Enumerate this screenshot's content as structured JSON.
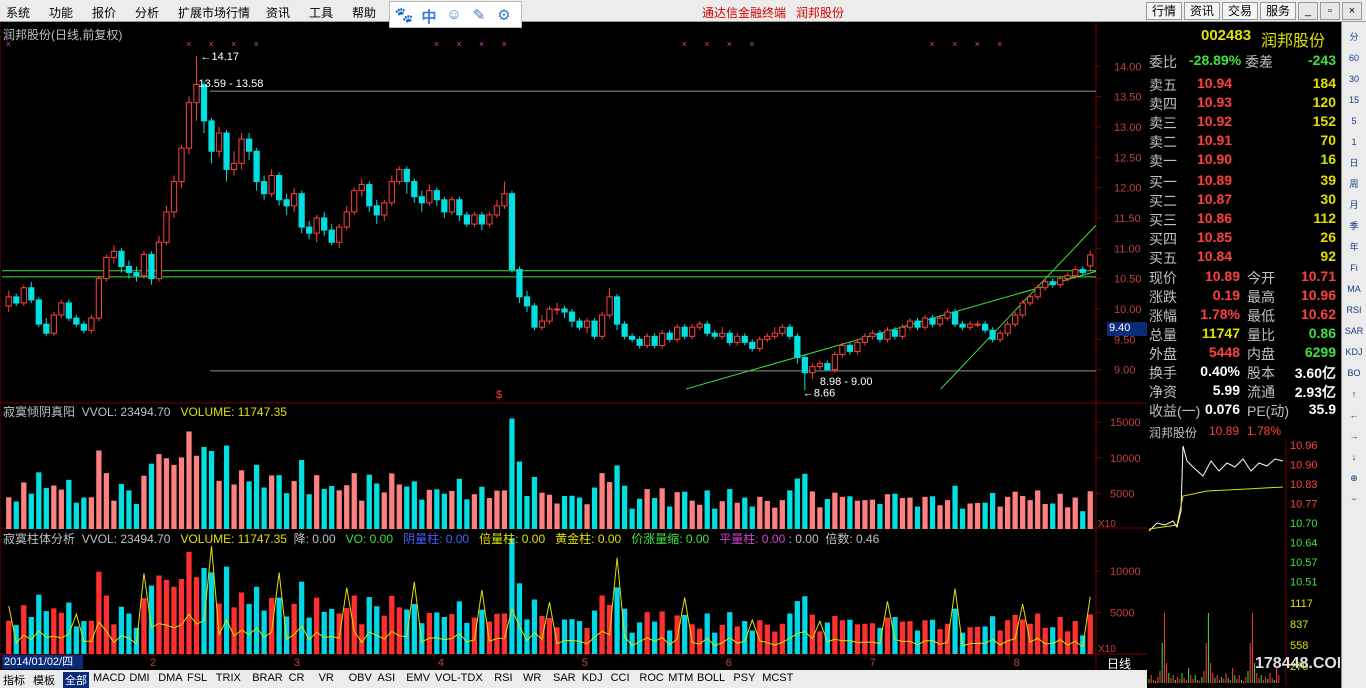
{
  "menu": [
    "系统",
    "功能",
    "报价",
    "分析",
    "扩展市场行情",
    "资讯",
    "工具",
    "帮助"
  ],
  "float_toolbar_icons": [
    "paw-icon",
    "chinese-input-icon",
    "smiley-icon",
    "pen-icon",
    "gear-icon"
  ],
  "float_toolbar_input_glyph": "中",
  "menu_title": {
    "left": "通达信金融终端",
    "right": "润邦股份"
  },
  "right_buttons": [
    "行情",
    "资讯",
    "交易",
    "服务"
  ],
  "chart": {
    "title": "润邦股份(日线,前复权)",
    "price_axis": [
      "14.00",
      "13.50",
      "13.00",
      "12.50",
      "12.00",
      "11.50",
      "11.00",
      "10.50",
      "10.00",
      "9.50",
      "9.00"
    ],
    "price_range": [
      8.5,
      14.4
    ],
    "current_price_label": "9.40",
    "annotations": {
      "high": "14.17",
      "high_range": "13.59 - 13.58",
      "low": "8.66",
      "low_range": "8.98 - 9.00"
    },
    "marker": "$",
    "hlines": [
      13.59,
      10.63,
      10.53,
      8.98
    ],
    "trendlines": [
      {
        "from": [
          0.625,
          8.68
        ],
        "to": [
          1.0,
          10.62
        ]
      },
      {
        "from": [
          0.858,
          8.68
        ],
        "to": [
          1.0,
          11.38
        ]
      }
    ],
    "candles": [
      [
        10.05,
        10.2,
        10.3,
        9.95
      ],
      [
        10.2,
        10.1,
        10.25,
        10.05
      ],
      [
        10.1,
        10.35,
        10.4,
        10.05
      ],
      [
        10.35,
        10.15,
        10.45,
        10.1
      ],
      [
        10.15,
        9.75,
        10.2,
        9.7
      ],
      [
        9.75,
        9.6,
        9.85,
        9.55
      ],
      [
        9.6,
        9.9,
        9.95,
        9.55
      ],
      [
        9.9,
        10.1,
        10.15,
        9.85
      ],
      [
        10.1,
        9.85,
        10.15,
        9.8
      ],
      [
        9.85,
        9.75,
        9.9,
        9.7
      ],
      [
        9.75,
        9.65,
        9.8,
        9.6
      ],
      [
        9.65,
        9.85,
        9.9,
        9.6
      ],
      [
        9.85,
        10.5,
        10.55,
        9.8
      ],
      [
        10.5,
        10.85,
        10.9,
        10.45
      ],
      [
        10.85,
        10.95,
        11.05,
        10.75
      ],
      [
        10.95,
        10.7,
        11.0,
        10.6
      ],
      [
        10.7,
        10.6,
        10.8,
        10.5
      ],
      [
        10.6,
        10.55,
        10.7,
        10.45
      ],
      [
        10.55,
        10.9,
        10.95,
        10.5
      ],
      [
        10.9,
        10.5,
        10.95,
        10.4
      ],
      [
        10.5,
        11.1,
        11.2,
        10.45
      ],
      [
        11.1,
        11.6,
        11.7,
        11.05
      ],
      [
        11.6,
        12.1,
        12.2,
        11.5
      ],
      [
        12.1,
        12.65,
        12.7,
        12.0
      ],
      [
        12.65,
        13.4,
        13.5,
        12.55
      ],
      [
        13.4,
        13.7,
        14.17,
        13.1
      ],
      [
        13.7,
        13.1,
        13.75,
        12.9
      ],
      [
        13.1,
        12.6,
        13.15,
        12.4
      ],
      [
        12.6,
        12.9,
        13.0,
        12.5
      ],
      [
        12.9,
        12.3,
        12.95,
        12.1
      ],
      [
        12.3,
        12.4,
        12.6,
        12.2
      ],
      [
        12.4,
        12.8,
        12.9,
        12.3
      ],
      [
        12.8,
        12.6,
        12.9,
        12.45
      ],
      [
        12.6,
        12.1,
        12.65,
        11.95
      ],
      [
        12.1,
        11.9,
        12.2,
        11.8
      ],
      [
        11.9,
        12.2,
        12.3,
        11.85
      ],
      [
        12.2,
        11.8,
        12.25,
        11.7
      ],
      [
        11.8,
        11.7,
        11.9,
        11.55
      ],
      [
        11.7,
        11.9,
        12.0,
        11.6
      ],
      [
        11.9,
        11.35,
        11.95,
        11.25
      ],
      [
        11.35,
        11.25,
        11.45,
        11.15
      ],
      [
        11.25,
        11.5,
        11.55,
        11.1
      ],
      [
        11.5,
        11.3,
        11.6,
        11.2
      ],
      [
        11.3,
        11.1,
        11.4,
        11.05
      ],
      [
        11.1,
        11.35,
        11.4,
        11.0
      ],
      [
        11.35,
        11.6,
        11.7,
        11.3
      ],
      [
        11.6,
        11.95,
        12.0,
        11.55
      ],
      [
        11.95,
        12.05,
        12.15,
        11.85
      ],
      [
        12.05,
        11.7,
        12.1,
        11.6
      ],
      [
        11.7,
        11.55,
        11.8,
        11.4
      ],
      [
        11.55,
        11.75,
        11.8,
        11.45
      ],
      [
        11.75,
        12.1,
        12.2,
        11.7
      ],
      [
        12.1,
        12.3,
        12.35,
        12.05
      ],
      [
        12.3,
        12.1,
        12.35,
        11.9
      ],
      [
        12.1,
        11.85,
        12.15,
        11.75
      ],
      [
        11.85,
        11.75,
        11.95,
        11.6
      ],
      [
        11.75,
        11.95,
        12.05,
        11.7
      ],
      [
        11.95,
        11.8,
        12.0,
        11.7
      ],
      [
        11.8,
        11.6,
        11.85,
        11.5
      ],
      [
        11.6,
        11.8,
        11.85,
        11.55
      ],
      [
        11.8,
        11.55,
        11.85,
        11.45
      ],
      [
        11.55,
        11.4,
        11.6,
        11.35
      ],
      [
        11.4,
        11.55,
        11.6,
        11.35
      ],
      [
        11.55,
        11.4,
        11.6,
        11.3
      ],
      [
        11.4,
        11.55,
        11.6,
        11.35
      ],
      [
        11.55,
        11.7,
        11.8,
        11.5
      ],
      [
        11.7,
        11.9,
        12.1,
        11.65
      ],
      [
        11.9,
        10.65,
        11.95,
        10.6
      ],
      [
        10.65,
        10.2,
        10.7,
        10.1
      ],
      [
        10.2,
        10.05,
        10.3,
        9.95
      ],
      [
        10.05,
        9.7,
        10.1,
        9.65
      ],
      [
        9.7,
        9.8,
        9.9,
        9.65
      ],
      [
        9.8,
        10.0,
        10.05,
        9.75
      ],
      [
        10.0,
        10.0,
        10.1,
        9.9
      ],
      [
        10.0,
        9.95,
        10.05,
        9.85
      ],
      [
        9.95,
        9.8,
        10.0,
        9.7
      ],
      [
        9.8,
        9.7,
        9.85,
        9.65
      ],
      [
        9.7,
        9.8,
        9.85,
        9.6
      ],
      [
        9.8,
        9.55,
        9.85,
        9.5
      ],
      [
        9.55,
        9.9,
        9.95,
        9.5
      ],
      [
        9.9,
        10.2,
        10.35,
        9.85
      ],
      [
        10.2,
        9.75,
        10.25,
        9.65
      ],
      [
        9.75,
        9.55,
        9.8,
        9.5
      ],
      [
        9.55,
        9.5,
        9.6,
        9.45
      ],
      [
        9.5,
        9.4,
        9.55,
        9.35
      ],
      [
        9.4,
        9.55,
        9.6,
        9.35
      ],
      [
        9.55,
        9.4,
        9.6,
        9.35
      ],
      [
        9.4,
        9.6,
        9.65,
        9.35
      ],
      [
        9.6,
        9.5,
        9.65,
        9.45
      ],
      [
        9.5,
        9.7,
        9.75,
        9.45
      ],
      [
        9.7,
        9.55,
        9.75,
        9.5
      ],
      [
        9.55,
        9.7,
        9.75,
        9.5
      ],
      [
        9.7,
        9.75,
        9.8,
        9.65
      ],
      [
        9.75,
        9.6,
        9.8,
        9.55
      ],
      [
        9.6,
        9.55,
        9.65,
        9.5
      ],
      [
        9.55,
        9.6,
        9.7,
        9.5
      ],
      [
        9.6,
        9.45,
        9.65,
        9.4
      ],
      [
        9.45,
        9.55,
        9.6,
        9.4
      ],
      [
        9.55,
        9.45,
        9.6,
        9.4
      ],
      [
        9.45,
        9.35,
        9.5,
        9.3
      ],
      [
        9.35,
        9.5,
        9.55,
        9.3
      ],
      [
        9.5,
        9.55,
        9.6,
        9.45
      ],
      [
        9.55,
        9.6,
        9.7,
        9.5
      ],
      [
        9.6,
        9.7,
        9.75,
        9.55
      ],
      [
        9.7,
        9.55,
        9.75,
        9.5
      ],
      [
        9.55,
        9.2,
        9.6,
        9.1
      ],
      [
        9.2,
        8.95,
        9.25,
        8.66
      ],
      [
        8.95,
        9.05,
        9.1,
        8.85
      ],
      [
        9.05,
        9.1,
        9.15,
        9.0
      ],
      [
        9.1,
        9.0,
        9.15,
        8.98
      ],
      [
        9.0,
        9.25,
        9.3,
        8.95
      ],
      [
        9.25,
        9.4,
        9.45,
        9.2
      ],
      [
        9.4,
        9.3,
        9.45,
        9.25
      ],
      [
        9.3,
        9.45,
        9.5,
        9.25
      ],
      [
        9.45,
        9.55,
        9.6,
        9.4
      ],
      [
        9.55,
        9.6,
        9.65,
        9.5
      ],
      [
        9.6,
        9.5,
        9.65,
        9.45
      ],
      [
        9.5,
        9.65,
        9.7,
        9.45
      ],
      [
        9.65,
        9.55,
        9.7,
        9.5
      ],
      [
        9.55,
        9.7,
        9.75,
        9.5
      ],
      [
        9.7,
        9.8,
        9.85,
        9.65
      ],
      [
        9.8,
        9.7,
        9.85,
        9.65
      ],
      [
        9.7,
        9.85,
        9.9,
        9.65
      ],
      [
        9.85,
        9.75,
        9.9,
        9.7
      ],
      [
        9.75,
        9.85,
        9.9,
        9.7
      ],
      [
        9.85,
        9.95,
        10.0,
        9.8
      ],
      [
        9.95,
        9.75,
        10.0,
        9.7
      ],
      [
        9.75,
        9.7,
        9.8,
        9.65
      ],
      [
        9.7,
        9.75,
        9.8,
        9.65
      ],
      [
        9.75,
        9.75,
        9.8,
        9.7
      ],
      [
        9.75,
        9.65,
        9.8,
        9.6
      ],
      [
        9.65,
        9.5,
        9.7,
        9.45
      ],
      [
        9.5,
        9.6,
        9.65,
        9.45
      ],
      [
        9.6,
        9.75,
        9.8,
        9.55
      ],
      [
        9.75,
        9.9,
        9.95,
        9.7
      ],
      [
        9.9,
        10.1,
        10.15,
        9.85
      ],
      [
        10.1,
        10.2,
        10.25,
        10.05
      ],
      [
        10.2,
        10.35,
        10.4,
        10.15
      ],
      [
        10.35,
        10.45,
        10.5,
        10.3
      ],
      [
        10.45,
        10.4,
        10.5,
        10.35
      ],
      [
        10.4,
        10.5,
        10.55,
        10.35
      ],
      [
        10.5,
        10.55,
        10.6,
        10.45
      ],
      [
        10.55,
        10.65,
        10.7,
        10.5
      ],
      [
        10.65,
        10.6,
        10.7,
        10.55
      ],
      [
        10.71,
        10.89,
        10.96,
        10.62
      ]
    ],
    "volume_title": {
      "name": "寂寞倾阴真阳",
      "vvol": "VVOL: 23494.70",
      "volume": "VOLUME: 11747.35"
    },
    "volume_axis": [
      "15000",
      "10000",
      "5000"
    ],
    "volume_scale": "X10",
    "indicator_title": {
      "name": "寂寞柱体分析",
      "vvol": "VVOL: 23494.70",
      "volume": "VOLUME: 11747.35",
      "jiang": "降: 0.00",
      "vo": "VO: 0.00",
      "yinliang": "阴量柱: 0.00",
      "beiliang": "倍量柱: 0.00",
      "huangjin": "黄金柱: 0.00",
      "jiazhang": "价涨量缩: 0.00",
      "pingliang": "平量柱: 0.00",
      "tail": ": 0.00",
      "beishu": "倍数: 0.46"
    },
    "indicator_axis": [
      "10000",
      "5000"
    ],
    "date_label": "2014/01/02/四",
    "month_labels": [
      "2",
      "3",
      "4",
      "5",
      "6",
      "7",
      "8"
    ],
    "period": "日线",
    "colors": {
      "up": "#ff4040",
      "down": "#00e0e0",
      "vol_up": "#ff8080",
      "line": "#40e040",
      "grid": "#7a0000"
    }
  },
  "quote": {
    "code": "002483",
    "name": "润邦股份",
    "weibi": {
      "label": "委比",
      "value": "-28.89%",
      "label2": "委差",
      "value2": "-243"
    },
    "asks": [
      [
        "卖五",
        "10.94",
        "184"
      ],
      [
        "卖四",
        "10.93",
        "120"
      ],
      [
        "卖三",
        "10.92",
        "152"
      ],
      [
        "卖二",
        "10.91",
        "70"
      ],
      [
        "卖一",
        "10.90",
        "16"
      ]
    ],
    "bids": [
      [
        "买一",
        "10.89",
        "39"
      ],
      [
        "买二",
        "10.87",
        "30"
      ],
      [
        "买三",
        "10.86",
        "112"
      ],
      [
        "买四",
        "10.85",
        "26"
      ],
      [
        "买五",
        "10.84",
        "92"
      ]
    ],
    "stats": [
      [
        "现价",
        "10.89",
        "今开",
        "10.71"
      ],
      [
        "涨跌",
        "0.19",
        "最高",
        "10.96"
      ],
      [
        "涨幅",
        "1.78%",
        "最低",
        "10.62"
      ],
      [
        "总量",
        "11747",
        "量比",
        "0.86"
      ],
      [
        "外盘",
        "5448",
        "内盘",
        "6299"
      ],
      [
        "换手",
        "0.40%",
        "股本",
        "3.60亿"
      ],
      [
        "净资",
        "5.99",
        "流通",
        "2.93亿"
      ],
      [
        "收益(一)",
        "0.076",
        "PE(动)",
        "35.9"
      ]
    ]
  },
  "mini": {
    "name": "润邦股份",
    "price": "10.89",
    "change": "1.78%",
    "axis": [
      "10.96",
      "10.90",
      "10.83",
      "10.77",
      "10.70",
      "10.64",
      "10.57",
      "10.51"
    ],
    "vol_axis": [
      "1117",
      "837",
      "558",
      "279"
    ],
    "watermark": "178448.COM"
  },
  "bottom_tabs": [
    "指标",
    "模板",
    "全部",
    "MACD",
    "DMI",
    "DMA",
    "FSL",
    "TRIX",
    "BRAR",
    "CR",
    "VR",
    "OBV",
    "ASI",
    "EMV",
    "VOL-TDX",
    "RSI",
    "WR",
    "SAR",
    "KDJ",
    "CCI",
    "ROC",
    "MTM",
    "BOLL",
    "PSY",
    "MCST"
  ],
  "right_tool_icons": [
    "分",
    "60",
    "30",
    "15",
    "5",
    "1",
    "日",
    "周",
    "月",
    "季",
    "年",
    "Fi",
    "MA",
    "RSI",
    "SAR",
    "KDJ",
    "BO",
    "↑",
    "←",
    "→",
    "↓",
    "⊕",
    "−"
  ]
}
